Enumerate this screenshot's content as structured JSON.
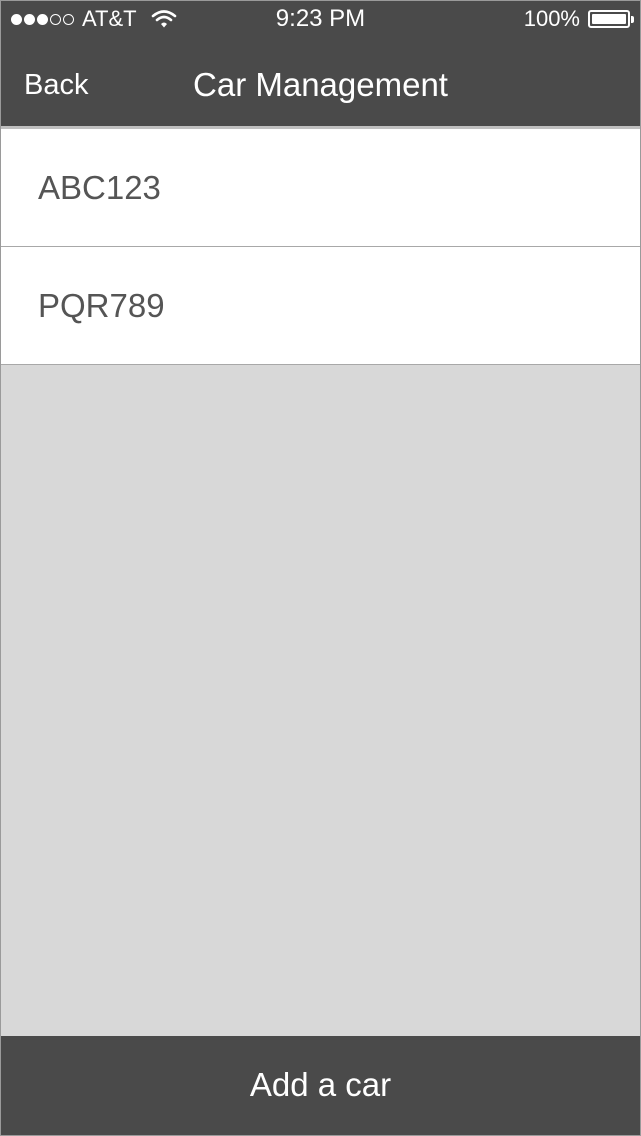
{
  "status_bar": {
    "signal_strength": "3 of 5",
    "carrier": "AT&T",
    "wifi_icon": "wifi-icon",
    "time": "9:23 PM",
    "battery_percent": "100%",
    "battery_icon": "battery-icon"
  },
  "nav": {
    "back_label": "Back",
    "title": "Car Management"
  },
  "cars": [
    {
      "plate": "ABC123"
    },
    {
      "plate": "PQR789"
    }
  ],
  "footer": {
    "add_label": "Add a car"
  },
  "colors": {
    "bar_background": "#4a4a4a",
    "list_background": "#ffffff",
    "screen_background": "#d8d8d8",
    "text_on_bar": "#ffffff",
    "row_text": "#555555"
  }
}
